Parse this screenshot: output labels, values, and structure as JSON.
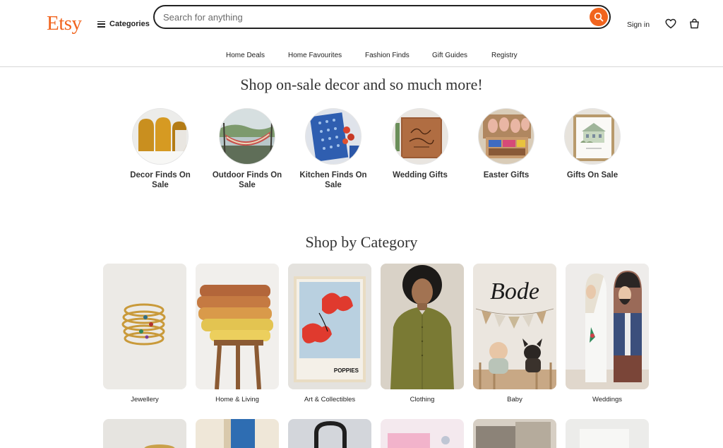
{
  "header": {
    "logo": "Etsy",
    "categories_label": "Categories",
    "search_placeholder": "Search for anything",
    "signin_label": "Sign in",
    "icons": [
      "menu-icon",
      "search-icon",
      "heart-icon",
      "shopping-bag-icon"
    ],
    "accent_color": "#F1641E"
  },
  "subnav": {
    "items": [
      "Home Deals",
      "Home Favourites",
      "Fashion Finds",
      "Gift Guides",
      "Registry"
    ]
  },
  "promo": {
    "title": "Shop on-sale decor and so much more!",
    "items": [
      {
        "label": "Decor Finds On Sale"
      },
      {
        "label": "Outdoor Finds On Sale"
      },
      {
        "label": "Kitchen Finds On Sale"
      },
      {
        "label": "Wedding Gifts"
      },
      {
        "label": "Easter Gifts"
      },
      {
        "label": "Gifts On Sale"
      }
    ]
  },
  "categories": {
    "title": "Shop by Category",
    "items": [
      {
        "label": "Jewellery"
      },
      {
        "label": "Home & Living"
      },
      {
        "label": "Art & Collectibles"
      },
      {
        "label": "Clothing"
      },
      {
        "label": "Baby"
      },
      {
        "label": "Weddings"
      }
    ],
    "image_text": {
      "art_poster": "POPPIES",
      "baby_sign": "Bode"
    }
  }
}
